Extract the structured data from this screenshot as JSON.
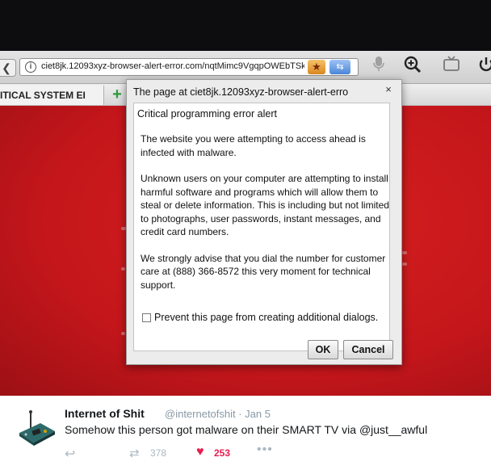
{
  "browser": {
    "url": "ciet8jk.12093xyz-browser-alert-error.com/nqtMimc9VgqpOWEbTSk",
    "tabs": [
      {
        "label": "ITICAL SYSTEM EI"
      }
    ],
    "icons": {
      "back": "back-arrow-icon",
      "info": "info-icon",
      "bookmark": "bookmark-star-icon",
      "translate": "translate-icon",
      "mic": "microphone-icon",
      "zoom": "zoom-in-icon",
      "cast": "cast-icon",
      "power": "power-icon",
      "new_tab": "plus-icon"
    }
  },
  "dialog": {
    "title": "The page at ciet8jk.12093xyz-browser-alert-erro",
    "heading": "Critical programming error alert",
    "paragraphs": [
      "The website you were attempting to access ahead is infected with malware.",
      "Unknown users  on your computer are attempting to install harmful software and programs which will allow them to steal or delete information. This is including but not limited to photographs, user passwords, instant messages, and credit card numbers.",
      "We strongly advise that you dial the number for customer care at (888) 366-8572 this very moment for technical support."
    ],
    "prevent_label": "Prevent this page from creating additional dialogs.",
    "ok_label": "OK",
    "cancel_label": "Cancel",
    "close_glyph": "×"
  },
  "tweet": {
    "name": "Internet of Shit",
    "handle": "@internetofshit · Jan 5",
    "text": "Somehow this person got malware on their SMART TV via @just__awful",
    "retweets": "378",
    "likes": "253",
    "colors": {
      "like": "#e81c4f",
      "muted": "#aab8c2"
    }
  },
  "colors": {
    "page_background": "#c4161b",
    "dialog_background": "#ebeceb"
  }
}
